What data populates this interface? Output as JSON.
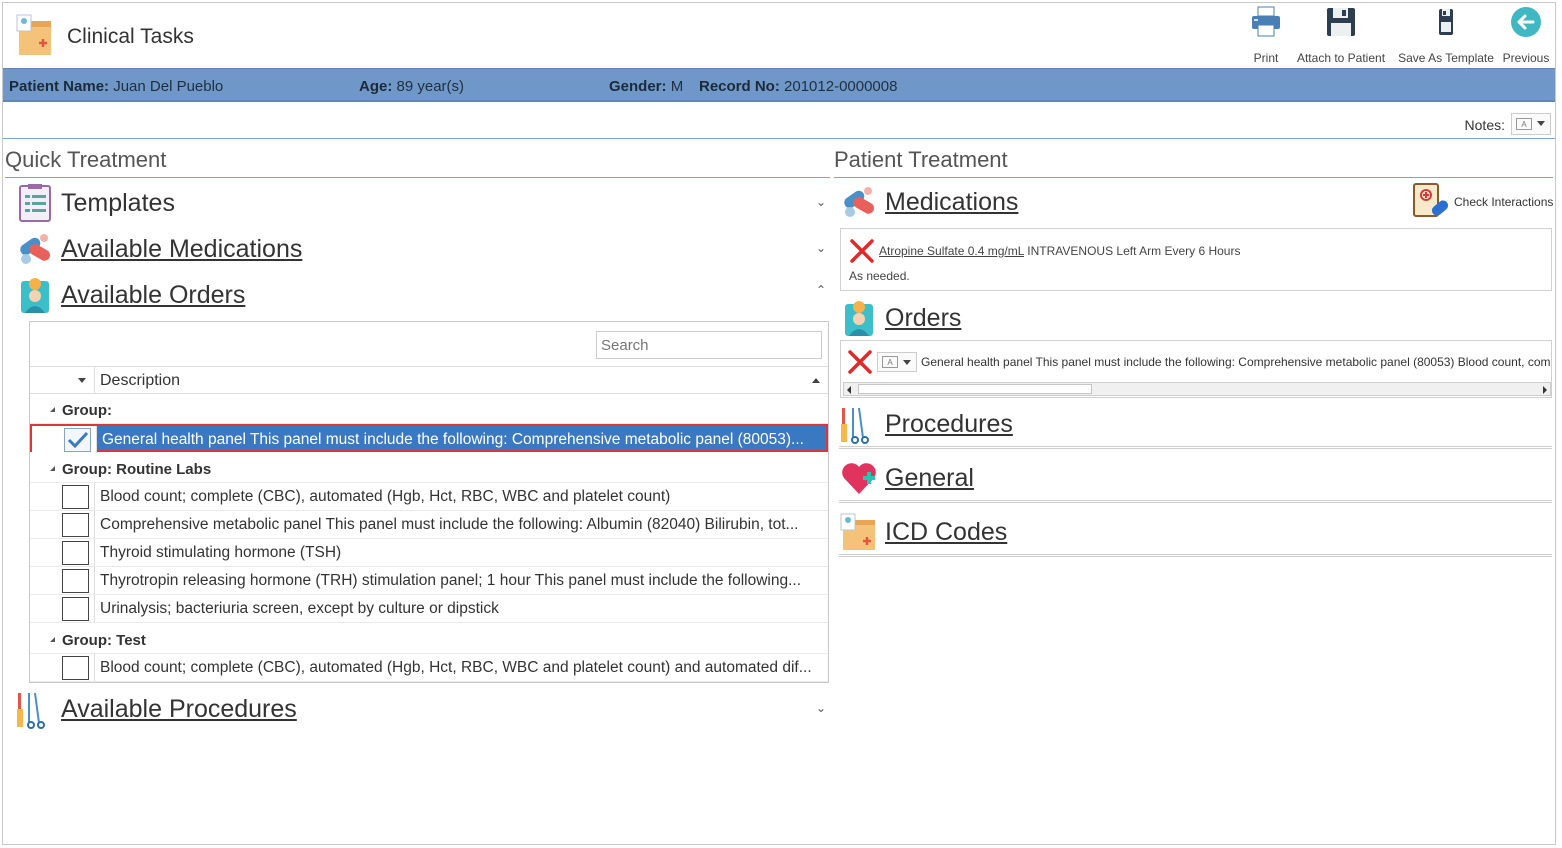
{
  "app": {
    "title": "Clinical Tasks"
  },
  "toolbar": {
    "print": "Print",
    "attach": "Attach to Patient",
    "save_template": "Save As Template",
    "previous": "Previous"
  },
  "patient": {
    "name_label": "Patient Name:",
    "name": "Juan Del Pueblo",
    "age_label": "Age:",
    "age": "89 year(s)",
    "gender_label": "Gender:",
    "gender": "M",
    "record_label": "Record No:",
    "record": "201012-0000008"
  },
  "notes": {
    "label": "Notes:"
  },
  "quick_treatment": {
    "title": "Quick Treatment",
    "templates": "Templates",
    "available_medications": "Available Medications",
    "available_orders": "Available Orders",
    "available_procedures": "Available Procedures",
    "search_placeholder": "Search",
    "column_description": "Description",
    "groups": [
      {
        "label": "Group:",
        "rows": [
          {
            "text": "General health panel This panel must include the following: Comprehensive metabolic panel (80053)...",
            "checked": true,
            "selected": true
          }
        ]
      },
      {
        "label": "Group: Routine Labs",
        "rows": [
          {
            "text": "Blood count; complete (CBC), automated (Hgb, Hct, RBC, WBC and platelet count)",
            "checked": false
          },
          {
            "text": "Comprehensive metabolic panel This panel must include the following: Albumin (82040) Bilirubin, tot...",
            "checked": false
          },
          {
            "text": "Thyroid stimulating hormone (TSH)",
            "checked": false
          },
          {
            "text": "Thyrotropin releasing hormone (TRH) stimulation panel; 1 hour This panel must include the following...",
            "checked": false
          },
          {
            "text": "Urinalysis; bacteriuria screen, except by culture or dipstick",
            "checked": false
          }
        ]
      },
      {
        "label": "Group: Test",
        "rows": [
          {
            "text": "Blood count; complete (CBC), automated (Hgb, Hct, RBC, WBC and platelet count) and automated dif...",
            "checked": false
          }
        ]
      }
    ]
  },
  "patient_treatment": {
    "title": "Patient Treatment",
    "medications": "Medications",
    "check_interactions": "Check Interactions",
    "medication_item": {
      "drug": "Atropine Sulfate  0.4 mg/mL",
      "details": " INTRAVENOUS Left Arm Every 6 Hours",
      "note": "As needed."
    },
    "orders": "Orders",
    "order_item": "General health panel This panel must include the following: Comprehensive metabolic panel (80053) Blood count, comp",
    "procedures": "Procedures",
    "general": "General",
    "icd_codes": "ICD Codes"
  },
  "colors": {
    "band": "#6f98c8",
    "selected_row": "#3b78c2",
    "highlight_border": "#d93838",
    "remove_icon": "#e02a2a"
  }
}
